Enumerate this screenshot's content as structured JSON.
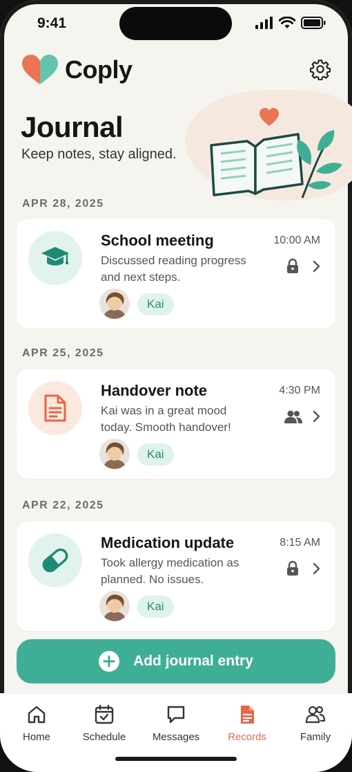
{
  "status_bar": {
    "time": "9:41"
  },
  "app": {
    "name": "Coply"
  },
  "page": {
    "title": "Journal",
    "subtitle": "Keep notes, stay aligned."
  },
  "colors": {
    "accent_green": "#3fae96",
    "accent_orange": "#e8654a",
    "background": "#f6f4ef",
    "tag_bg": "#dff2ec"
  },
  "entries": [
    {
      "date": "APR 28, 2025",
      "title": "School meeting",
      "body": "Discussed reading progress and next steps.",
      "time": "10:00 AM",
      "icon": "graduation-cap-icon",
      "status_icon": "lock-icon",
      "tag": "Kai"
    },
    {
      "date": "APR 25, 2025",
      "title": "Handover note",
      "body": "Kai was in a great mood today. Smooth handover!",
      "time": "4:30 PM",
      "icon": "document-icon",
      "status_icon": "people-icon",
      "tag": "Kai"
    },
    {
      "date": "APR 22, 2025",
      "title": "Medication update",
      "body": "Took allergy medication as planned. No issues.",
      "time": "8:15 AM",
      "icon": "pill-icon",
      "status_icon": "lock-icon",
      "tag": "Kai"
    }
  ],
  "add_button": {
    "label": "Add journal entry"
  },
  "tabs": [
    {
      "label": "Home",
      "icon": "home-icon"
    },
    {
      "label": "Schedule",
      "icon": "calendar-icon"
    },
    {
      "label": "Messages",
      "icon": "chat-icon"
    },
    {
      "label": "Records",
      "icon": "records-icon",
      "active": true
    },
    {
      "label": "Family",
      "icon": "family-icon"
    }
  ]
}
